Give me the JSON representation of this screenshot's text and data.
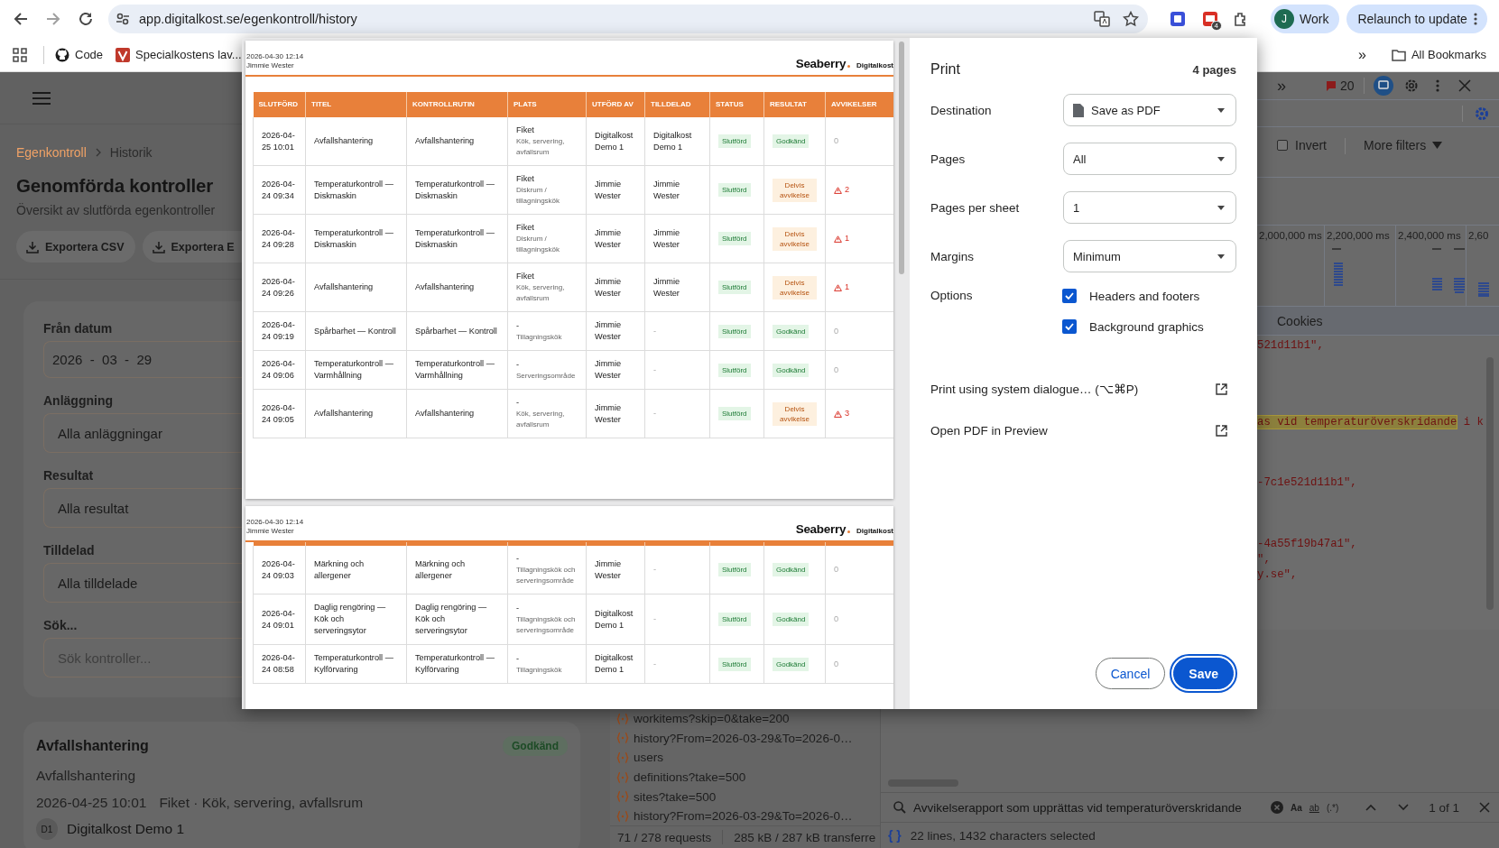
{
  "browser": {
    "url": "app.digitalkost.se/egenkontroll/history",
    "extension_badge": "4",
    "profile": {
      "initial": "J",
      "label": "Work"
    },
    "relaunch": "Relaunch to update",
    "bookmarks": [
      {
        "kind": "github",
        "label": "Code"
      },
      {
        "kind": "site",
        "label": "Specialkostens lav..."
      }
    ],
    "more_bookmarks": "»",
    "all_bookmarks": "All Bookmarks"
  },
  "app": {
    "breadcrumb": [
      {
        "label": "Egenkontroll",
        "link": true
      },
      {
        "label": "Historik",
        "link": false
      }
    ],
    "title": "Genomförda kontroller",
    "subtitle": "Översikt av slutförda egenkontroller",
    "exports": [
      "Exportera CSV",
      "Exportera E"
    ],
    "filters": [
      {
        "kind": "date",
        "label": "Från datum",
        "value": "2026  -  03  -  29"
      },
      {
        "kind": "select",
        "label": "Anläggning",
        "value": "Alla anläggningar"
      },
      {
        "kind": "select",
        "label": "Resultat",
        "value": "Alla resultat"
      },
      {
        "kind": "select",
        "label": "Tilldelad",
        "value": "Alla tilldelade"
      },
      {
        "kind": "search",
        "label": "Sök...",
        "placeholder": "Sök kontroller..."
      }
    ],
    "card": {
      "title": "Avfallshantering",
      "badge": "Godkänd",
      "routine": "Avfallshantering",
      "date": "2026-04-25 10:01",
      "place": "Fiket · Kök, servering, avfallsrum",
      "avatar": "D1",
      "person": "Digitalkost Demo 1"
    }
  },
  "devtools": {
    "more_tabs": "»",
    "errors": "20",
    "invert": {
      "label": "Invert",
      "checked": false
    },
    "more_filters": "More filters",
    "timeline_labels": [
      "2,000,000 ms",
      "2,200,000 ms",
      "2,400,000 ms",
      "2,60"
    ],
    "tab": "Cookies",
    "code_lines": [
      [
        {
          "text": "521d11b1\",",
          "highlight": false
        }
      ],
      [
        {
          "text": "as vid temperaturöverskridande",
          "highlight": true
        },
        {
          "text": " i k",
          "highlight": false
        }
      ],
      [
        {
          "text": "-7c1e521d11b1\",",
          "highlight": false
        }
      ],
      [
        {
          "text": "-4a55f19b47a1\",",
          "highlight": false
        }
      ],
      [
        {
          "text": "\",",
          "highlight": false
        }
      ],
      [
        {
          "text": "y.se\",",
          "highlight": false
        }
      ]
    ],
    "requests": [
      "workitems?skip=0&take=200",
      "history?From=2026-03-29&To=2026-0…",
      "users",
      "definitions?take=500",
      "sites?take=500",
      "history?From=2026-03-29&To=2026-0…"
    ],
    "summary": [
      "71 / 278 requests",
      "285 kB / 287 kB transferre"
    ],
    "search": {
      "value": "Avvikelserapport som upprättas vid temperaturöverskridande",
      "case": "Aa",
      "word": "ab",
      "regex": "(.*)",
      "count": "1 of 1"
    },
    "pretty": "{ }",
    "selection": "22 lines, 1432 characters selected"
  },
  "print": {
    "title": "Print",
    "pages_count": "4 pages",
    "settings": [
      {
        "kind": "destination",
        "label": "Destination",
        "value": "Save as PDF"
      },
      {
        "kind": "select",
        "label": "Pages",
        "value": "All"
      },
      {
        "kind": "select",
        "label": "Pages per sheet",
        "value": "1"
      },
      {
        "kind": "select",
        "label": "Margins",
        "value": "Minimum"
      }
    ],
    "options_label": "Options",
    "options": [
      {
        "label": "Headers and footers",
        "checked": true
      },
      {
        "label": "Background graphics",
        "checked": true
      }
    ],
    "links": [
      "Print using system dialogue… (⌥⌘P)",
      "Open PDF in Preview"
    ],
    "buttons": [
      {
        "label": "Cancel",
        "primary": false
      },
      {
        "label": "Save",
        "primary": true
      }
    ],
    "preview": {
      "columns": [
        "SLUTFÖRD",
        "TITEL",
        "KONTROLLRUTIN",
        "PLATS",
        "UTFÖRD AV",
        "TILLDELAD",
        "STATUS",
        "RESULTAT",
        "AVVIKELSER"
      ],
      "pages": [
        {
          "printed": "2026-04-30 12:14",
          "user": "Jimmie Wester",
          "brand": "Seaberry",
          "sub_brand": "Digitalkost",
          "column_titles": true,
          "rows": [
            {
              "completed": "2026-04-25 10:01",
              "title": "Avfallshantering",
              "routine": "Avfallshantering",
              "site": "Fiket",
              "area": "Kök, servering, avfallsrum",
              "done_by": "Digitalkost Demo 1",
              "assigned": {
                "name": "Digitalkost Demo 1",
                "muted": false
              },
              "status": "Slutförd",
              "result": {
                "kind": "approved",
                "label": "Godkänd"
              },
              "deviations": {
                "count": "0",
                "warning": false
              }
            },
            {
              "completed": "2026-04-24 09:34",
              "title": "Temperaturkontroll — Diskmaskin",
              "routine": "Temperaturkontroll — Diskmaskin",
              "site": "Fiket",
              "area": "Diskrum / tillagningskök",
              "done_by": "Jimmie Wester",
              "assigned": {
                "name": "Jimmie Wester",
                "muted": false
              },
              "status": "Slutförd",
              "result": {
                "kind": "partial",
                "label": "Delvis avvikelse"
              },
              "deviations": {
                "count": "2",
                "warning": true
              }
            },
            {
              "completed": "2026-04-24 09:28",
              "title": "Temperaturkontroll — Diskmaskin",
              "routine": "Temperaturkontroll — Diskmaskin",
              "site": "Fiket",
              "area": "Diskrum / tillagningskök",
              "done_by": "Jimmie Wester",
              "assigned": {
                "name": "Jimmie Wester",
                "muted": false
              },
              "status": "Slutförd",
              "result": {
                "kind": "partial",
                "label": "Delvis avvikelse"
              },
              "deviations": {
                "count": "1",
                "warning": true
              }
            },
            {
              "completed": "2026-04-24 09:26",
              "title": "Avfallshantering",
              "routine": "Avfallshantering",
              "site": "Fiket",
              "area": "Kök, servering, avfallsrum",
              "done_by": "Jimmie Wester",
              "assigned": {
                "name": "Jimmie Wester",
                "muted": false
              },
              "status": "Slutförd",
              "result": {
                "kind": "partial",
                "label": "Delvis avvikelse"
              },
              "deviations": {
                "count": "1",
                "warning": true
              }
            },
            {
              "completed": "2026-04-24 09:19",
              "title": "Spårbarhet — Kontroll",
              "routine": "Spårbarhet — Kontroll",
              "site": "-",
              "area": "Tillagningskök",
              "done_by": "Jimmie Wester",
              "assigned": {
                "name": "-",
                "muted": true
              },
              "status": "Slutförd",
              "result": {
                "kind": "approved",
                "label": "Godkänd"
              },
              "deviations": {
                "count": "0",
                "warning": false
              }
            },
            {
              "completed": "2026-04-24 09:06",
              "title": "Temperaturkontroll — Varmhållning",
              "routine": "Temperaturkontroll — Varmhållning",
              "site": "-",
              "area": "Serveringsområde",
              "done_by": "Jimmie Wester",
              "assigned": {
                "name": "-",
                "muted": true
              },
              "status": "Slutförd",
              "result": {
                "kind": "approved",
                "label": "Godkänd"
              },
              "deviations": {
                "count": "0",
                "warning": false
              }
            },
            {
              "completed": "2026-04-24 09:05",
              "title": "Avfallshantering",
              "routine": "Avfallshantering",
              "site": "-",
              "area": "Kök, servering, avfallsrum",
              "done_by": "Jimmie Wester",
              "assigned": {
                "name": "-",
                "muted": true
              },
              "status": "Slutförd",
              "result": {
                "kind": "partial",
                "label": "Delvis avvikelse"
              },
              "deviations": {
                "count": "3",
                "warning": true
              }
            }
          ]
        },
        {
          "printed": "2026-04-30 12:14",
          "user": "Jimmie Wester",
          "brand": "Seaberry",
          "sub_brand": "Digitalkost",
          "column_titles": false,
          "rows": [
            {
              "completed": "2026-04-24 09:03",
              "title": "Märkning och allergener",
              "routine": "Märkning och allergener",
              "site": "-",
              "area": "Tillagningskök och serveringsområde",
              "done_by": "Jimmie Wester",
              "assigned": {
                "name": "-",
                "muted": true
              },
              "status": "Slutförd",
              "result": {
                "kind": "approved",
                "label": "Godkänd"
              },
              "deviations": {
                "count": "0",
                "warning": false
              }
            },
            {
              "completed": "2026-04-24 09:01",
              "title": "Daglig rengöring — Kök och serveringsytor",
              "routine": "Daglig rengöring — Kök och serveringsytor",
              "site": "-",
              "area": "Tillagningskök och serveringsområde",
              "done_by": "Digitalkost Demo 1",
              "assigned": {
                "name": "-",
                "muted": true
              },
              "status": "Slutförd",
              "result": {
                "kind": "approved",
                "label": "Godkänd"
              },
              "deviations": {
                "count": "0",
                "warning": false
              }
            },
            {
              "completed": "2026-04-24 08:58",
              "title": "Temperaturkontroll — Kylförvaring",
              "routine": "Temperaturkontroll — Kylförvaring",
              "site": "-",
              "area": "Tillagningskök",
              "done_by": "Digitalkost Demo 1",
              "assigned": {
                "name": "-",
                "muted": true
              },
              "status": "Slutförd",
              "result": {
                "kind": "approved",
                "label": "Godkänd"
              },
              "deviations": {
                "count": "0",
                "warning": false
              }
            }
          ]
        }
      ]
    }
  }
}
